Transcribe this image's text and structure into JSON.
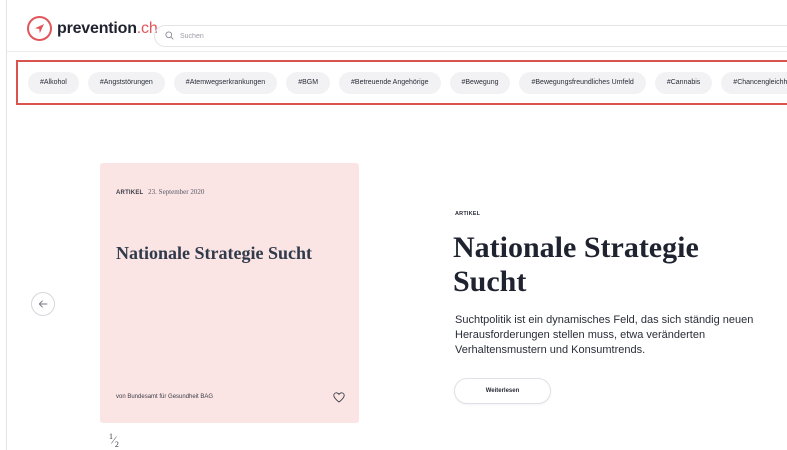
{
  "brand": {
    "name": "prevention",
    "tld": ".ch",
    "accent_color": "#e0565b"
  },
  "search": {
    "placeholder": "Suchen",
    "icon": "search-icon"
  },
  "tags": [
    "#Alkohol",
    "#Angststörungen",
    "#Atemwegserkrankungen",
    "#BGM",
    "#Betreuende Angehörige",
    "#Bewegung",
    "#Bewegungsfreundliches Umfeld",
    "#Cannabis",
    "#Chancengleichheit"
  ],
  "carousel": {
    "prev_icon": "arrow-left-icon",
    "page_current": "1",
    "page_total": "2"
  },
  "card": {
    "kicker": "ARTIKEL",
    "date": "23. September 2020",
    "title": "Nationale Strategie Sucht",
    "author": "von Bundesamt für Gesundheit BAG",
    "background": "#fbe4e4",
    "favorite_icon": "heart-icon"
  },
  "detail": {
    "kicker": "ARTIKEL",
    "title": "Nationale Strategie Sucht",
    "text": "Suchtpolitik ist ein dynamisches Feld, das sich ständig neuen Herausforderungen stellen muss, etwa veränderten Verhaltensmustern und Konsumtrends.",
    "button_label": "Weiterlesen"
  }
}
